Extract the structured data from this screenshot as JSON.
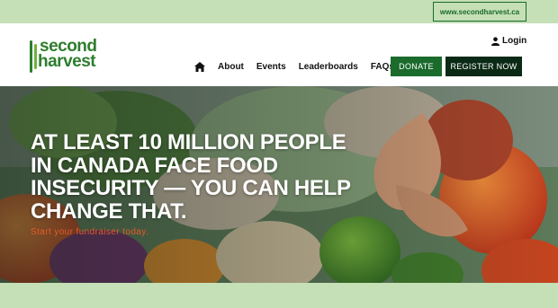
{
  "topbar": {
    "site_link": "www.secondharvest.ca"
  },
  "logo": {
    "line1": "second",
    "line2": "harvest"
  },
  "header": {
    "login_label": "Login",
    "nav": [
      "About",
      "Events",
      "Leaderboards",
      "FAQs"
    ],
    "donate_label": "DONATE",
    "register_label": "REGISTER NOW"
  },
  "hero": {
    "title": "AT LEAST 10 MILLION PEOPLE IN CANADA FACE FOOD INSECURITY — YOU CAN HELP CHANGE THAT.",
    "subtitle": "Start your fundraiser today."
  },
  "colors": {
    "brand_green": "#1a6b2c",
    "dark_green": "#0b2a15",
    "light_green": "#c5dfb6",
    "accent_orange": "#e45a2a"
  },
  "icons": {
    "home": "home-icon",
    "user": "user-icon"
  }
}
